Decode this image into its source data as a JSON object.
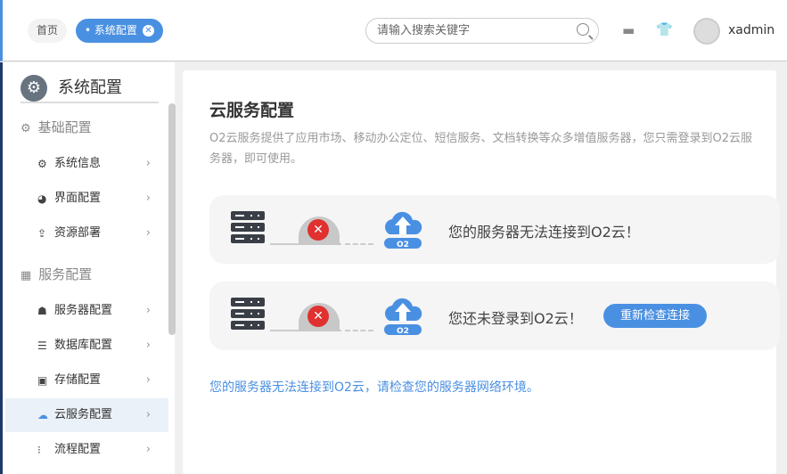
{
  "header": {
    "tabs": [
      {
        "label": "首页"
      },
      {
        "label": "系统配置"
      }
    ],
    "search_placeholder": "请输入搜索关键字",
    "username": "xadmin"
  },
  "sidebar": {
    "title": "系统配置",
    "groups": [
      {
        "label": "基础配置",
        "items": [
          {
            "label": "系统信息"
          },
          {
            "label": "界面配置"
          },
          {
            "label": "资源部署"
          }
        ]
      },
      {
        "label": "服务配置",
        "items": [
          {
            "label": "服务器配置"
          },
          {
            "label": "数据库配置"
          },
          {
            "label": "存储配置"
          },
          {
            "label": "云服务配置"
          },
          {
            "label": "流程配置"
          }
        ]
      }
    ]
  },
  "main": {
    "title": "云服务配置",
    "description": "O2云服务提供了应用市场、移动办公定位、短信服务、文档转换等众多增值服务器，您只需登录到O2云服务器，即可使用。",
    "cards": [
      {
        "message": "您的服务器无法连接到O2云！",
        "badge": "O2"
      },
      {
        "message": "您还未登录到O2云！",
        "badge": "O2",
        "button": "重新检查连接"
      }
    ],
    "note": "您的服务器无法连接到O2云，请检查您的服务器网络环境。"
  },
  "colors": {
    "accent": "#4a90e2",
    "error": "#e03030"
  }
}
